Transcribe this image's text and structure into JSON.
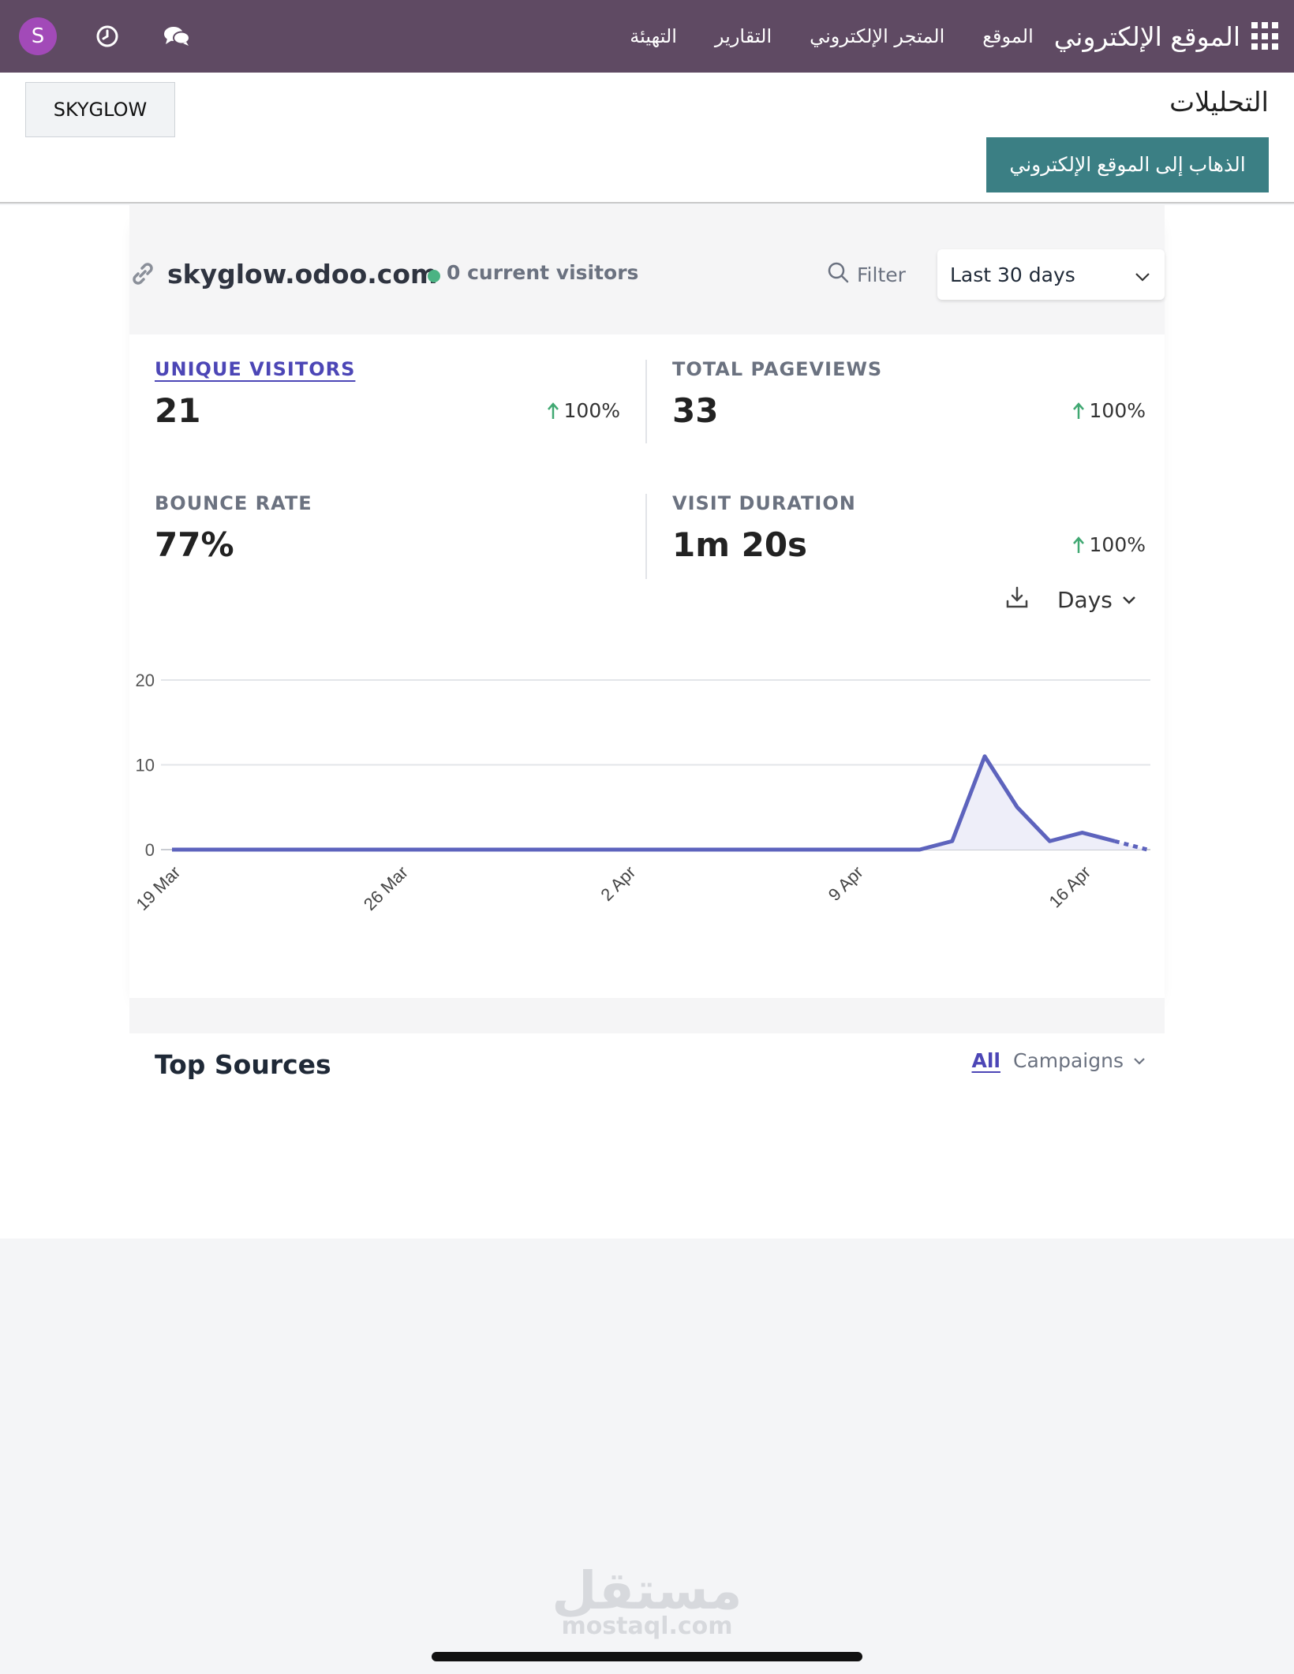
{
  "navbar": {
    "avatar_letter": "S",
    "brand": "الموقع الإلكتروني",
    "menu": [
      "الموقع",
      "المتجر الإلكتروني",
      "التقارير",
      "التهيئة"
    ],
    "icons": [
      "apps-icon",
      "clock-icon",
      "chat-icon"
    ]
  },
  "control": {
    "title": "التحليلات",
    "goto_label": "الذهاب إلى الموقع الإلكتروني",
    "company_label": "SKYGLOW"
  },
  "site": {
    "domain": "skyglow.odoo.com",
    "current_visitors": "0 current visitors",
    "filter_label": "Filter",
    "period": "Last 30 days"
  },
  "stats": {
    "unique_visitors": {
      "label": "UNIQUE VISITORS",
      "value": "21",
      "change": "100%"
    },
    "total_pageviews": {
      "label": "TOTAL PAGEVIEWS",
      "value": "33",
      "change": "100%"
    },
    "bounce_rate": {
      "label": "BOUNCE RATE",
      "value": "77%"
    },
    "visit_duration": {
      "label": "VISIT DURATION",
      "value": "1m 20s",
      "change": "100%"
    }
  },
  "toolbar": {
    "interval": "Days"
  },
  "chart_data": {
    "type": "area",
    "x": [
      "19 Mar",
      "20 Mar",
      "21 Mar",
      "22 Mar",
      "23 Mar",
      "24 Mar",
      "25 Mar",
      "26 Mar",
      "27 Mar",
      "28 Mar",
      "29 Mar",
      "30 Mar",
      "31 Mar",
      "1 Apr",
      "2 Apr",
      "3 Apr",
      "4 Apr",
      "5 Apr",
      "6 Apr",
      "7 Apr",
      "8 Apr",
      "9 Apr",
      "10 Apr",
      "11 Apr",
      "12 Apr",
      "13 Apr",
      "14 Apr",
      "15 Apr",
      "16 Apr",
      "17 Apr",
      "18 Apr"
    ],
    "series": [
      {
        "values": [
          0,
          0,
          0,
          0,
          0,
          0,
          0,
          0,
          0,
          0,
          0,
          0,
          0,
          0,
          0,
          0,
          0,
          0,
          0,
          0,
          0,
          0,
          0,
          0,
          1,
          11,
          5,
          1,
          2,
          1,
          0
        ]
      }
    ],
    "xticks": [
      "19 Mar",
      "26 Mar",
      "2 Apr",
      "9 Apr",
      "16 Apr"
    ],
    "yticks": [
      0,
      10,
      20
    ],
    "ylim": [
      0,
      20
    ],
    "color": "#5d63bd",
    "fill": "#eeeef9",
    "last_segment_dashed": true,
    "grid": true
  },
  "sources": {
    "title": "Top Sources",
    "tab_all": "All",
    "tab_campaigns": "Campaigns"
  },
  "watermark": {
    "arabic": "مستقل",
    "latin": "mostaql.com"
  }
}
